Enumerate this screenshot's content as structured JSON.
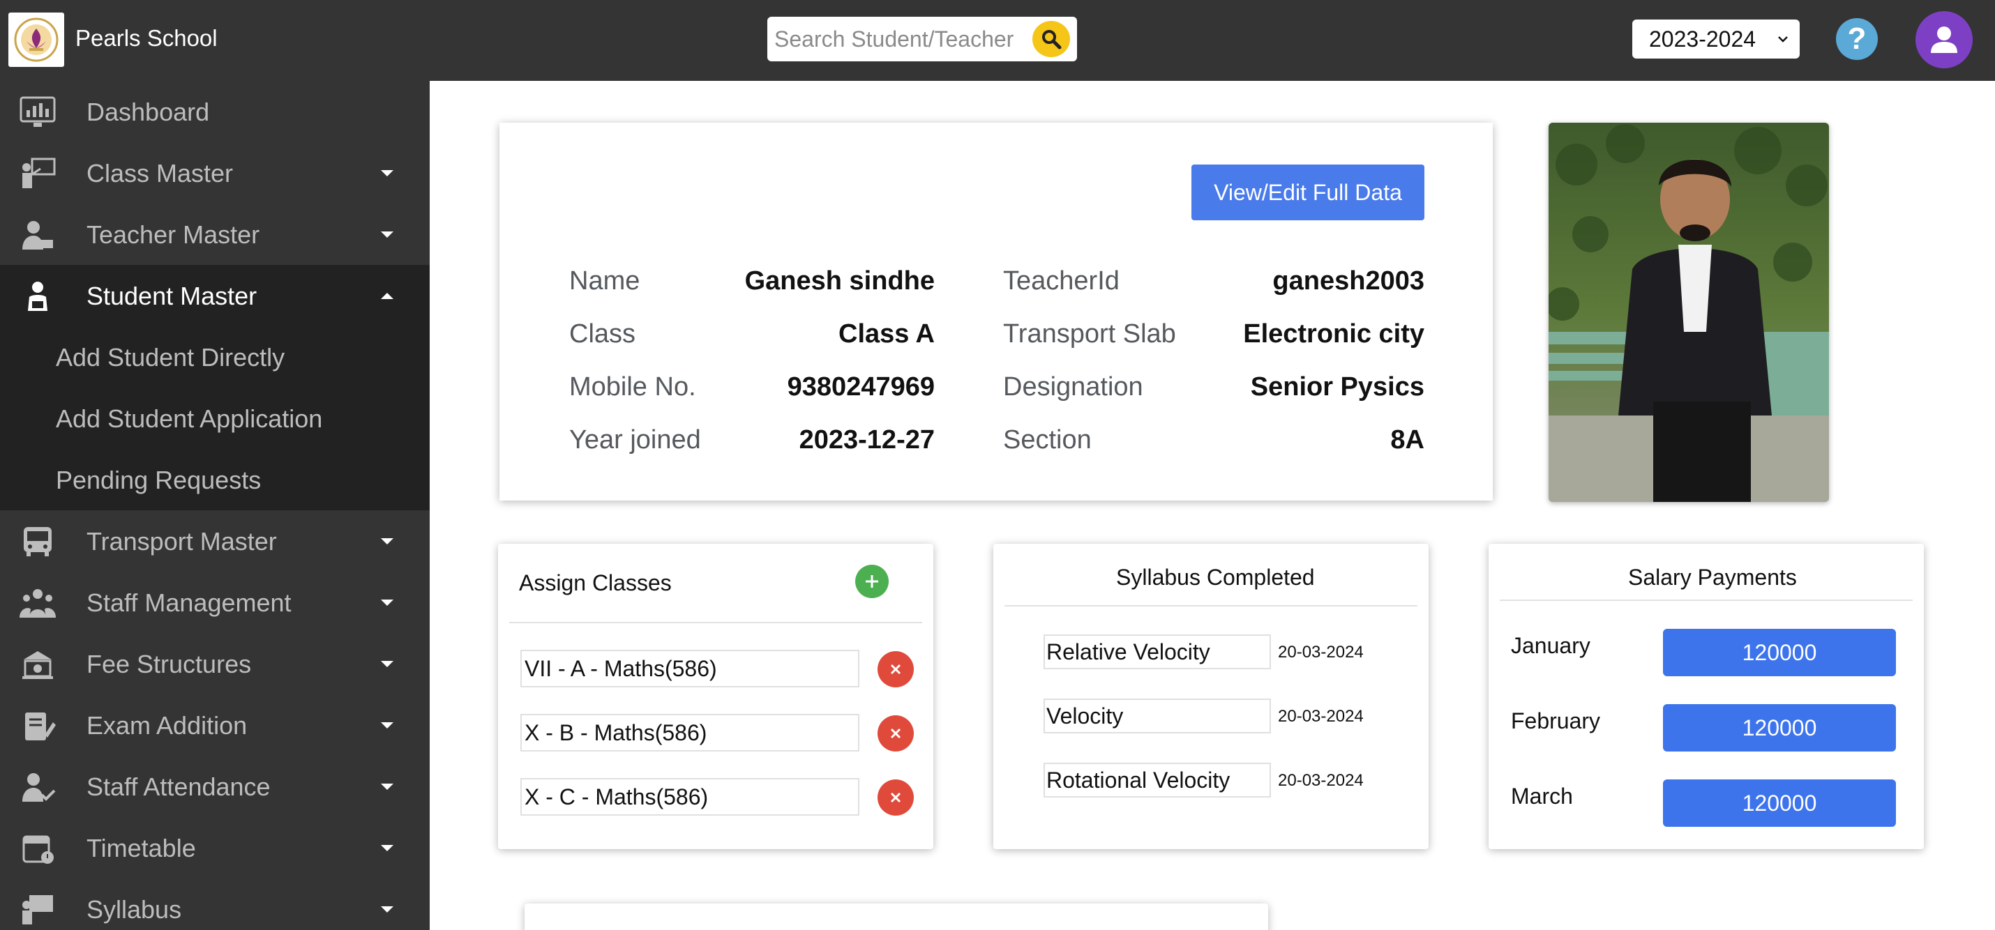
{
  "header": {
    "school_name": "Pearls School",
    "search_placeholder": "Search Student/Teacher",
    "academic_year": "2023-2024",
    "help_label": "?"
  },
  "sidebar": {
    "items": [
      {
        "label": "Dashboard",
        "icon": "dashboard-icon"
      },
      {
        "label": "Class Master",
        "icon": "class-master-icon"
      },
      {
        "label": "Teacher Master",
        "icon": "teacher-master-icon"
      },
      {
        "label": "Student Master",
        "icon": "student-master-icon"
      },
      {
        "label": "Transport Master",
        "icon": "bus-icon"
      },
      {
        "label": "Staff Management",
        "icon": "staff-group-icon"
      },
      {
        "label": "Fee Structures",
        "icon": "fee-icon"
      },
      {
        "label": "Exam Addition",
        "icon": "exam-icon"
      },
      {
        "label": "Staff Attendance",
        "icon": "attendance-icon"
      },
      {
        "label": "Timetable",
        "icon": "calendar-icon"
      },
      {
        "label": "Syllabus",
        "icon": "syllabus-icon"
      }
    ],
    "student_submenu": [
      "Add Student Directly",
      "Add Student Application",
      "Pending Requests"
    ]
  },
  "profile": {
    "view_button": "View/Edit Full Data",
    "fields_left": [
      {
        "label": "Name",
        "value": "Ganesh sindhe"
      },
      {
        "label": "Class",
        "value": "Class A"
      },
      {
        "label": "Mobile No.",
        "value": "9380247969"
      },
      {
        "label": "Year joined",
        "value": "2023-12-27"
      }
    ],
    "fields_right": [
      {
        "label": "TeacherId",
        "value": "ganesh2003"
      },
      {
        "label": "Transport Slab",
        "value": "Electronic city"
      },
      {
        "label": "Designation",
        "value": "Senior Pysics"
      },
      {
        "label": "Section",
        "value": "8A"
      }
    ]
  },
  "assign_classes": {
    "title": "Assign Classes",
    "items": [
      "VII - A - Maths(586)",
      "X - B - Maths(586)",
      "X - C - Maths(586)"
    ]
  },
  "syllabus": {
    "title": "Syllabus Completed",
    "items": [
      {
        "topic": "Relative Velocity",
        "date": "20-03-2024"
      },
      {
        "topic": "Velocity",
        "date": "20-03-2024"
      },
      {
        "topic": "Rotational Velocity",
        "date": "20-03-2024"
      }
    ]
  },
  "salary": {
    "title": "Salary Payments",
    "items": [
      {
        "month": "January",
        "amount": "120000"
      },
      {
        "month": "February",
        "amount": "120000"
      },
      {
        "month": "March",
        "amount": "120000"
      }
    ]
  },
  "colors": {
    "topbar": "#343434",
    "sidebar_active": "#222222",
    "primary_button": "#4a7bea",
    "search_button": "#f5c518",
    "add_green": "#4caf50",
    "remove_red": "#e04a3b",
    "avatar_purple": "#7d3fc4"
  }
}
